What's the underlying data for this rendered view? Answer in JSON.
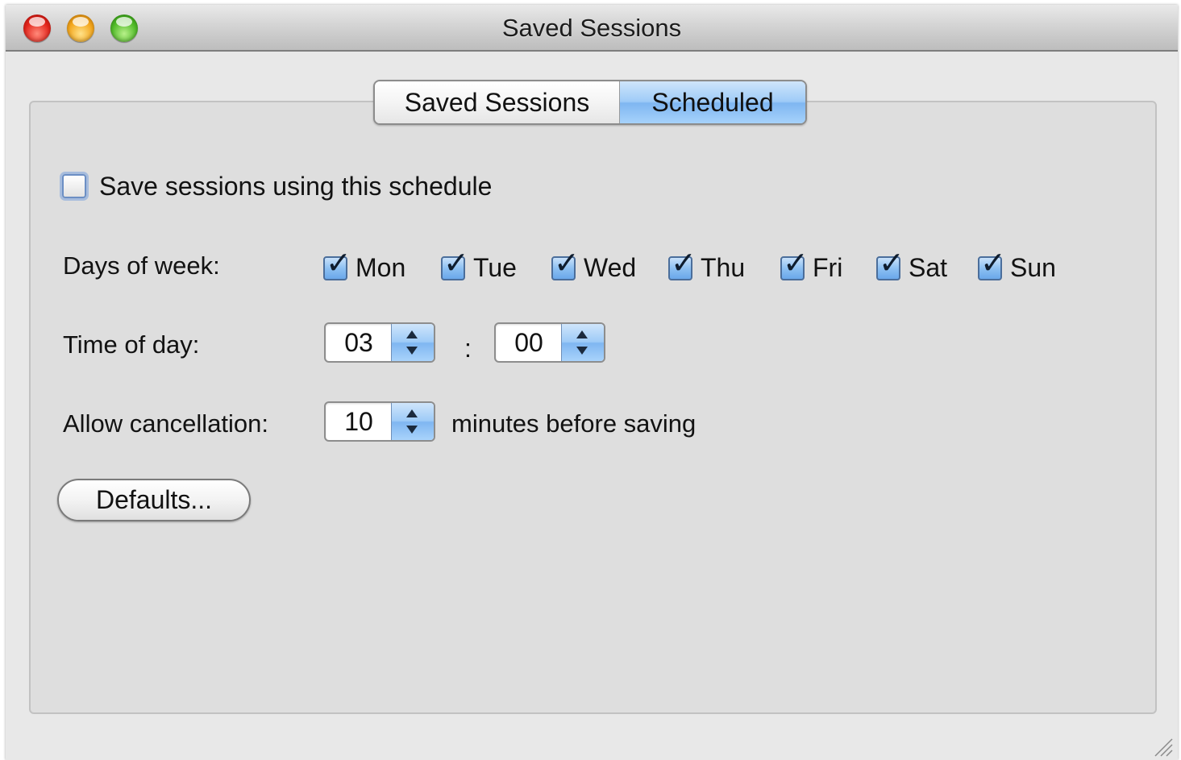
{
  "window": {
    "title": "Saved Sessions"
  },
  "tabs": [
    {
      "label": "Saved Sessions",
      "selected": false
    },
    {
      "label": "Scheduled",
      "selected": true
    }
  ],
  "schedule": {
    "enable_label": "Save sessions using this schedule",
    "enable_checked": false,
    "days_label": "Days of week:",
    "days": [
      {
        "label": "Mon",
        "checked": true
      },
      {
        "label": "Tue",
        "checked": true
      },
      {
        "label": "Wed",
        "checked": true
      },
      {
        "label": "Thu",
        "checked": true
      },
      {
        "label": "Fri",
        "checked": true
      },
      {
        "label": "Sat",
        "checked": true
      },
      {
        "label": "Sun",
        "checked": true
      }
    ],
    "time_label": "Time of day:",
    "hour": "03",
    "separator": ":",
    "minute": "00",
    "cancel_label": "Allow cancellation:",
    "cancel_minutes": "10",
    "cancel_suffix": "minutes before saving",
    "defaults_button": "Defaults..."
  },
  "colors": {
    "accent_blue": "#8dc0f2",
    "window_bg": "#e8e8e8",
    "panel_bg": "#dedede"
  }
}
